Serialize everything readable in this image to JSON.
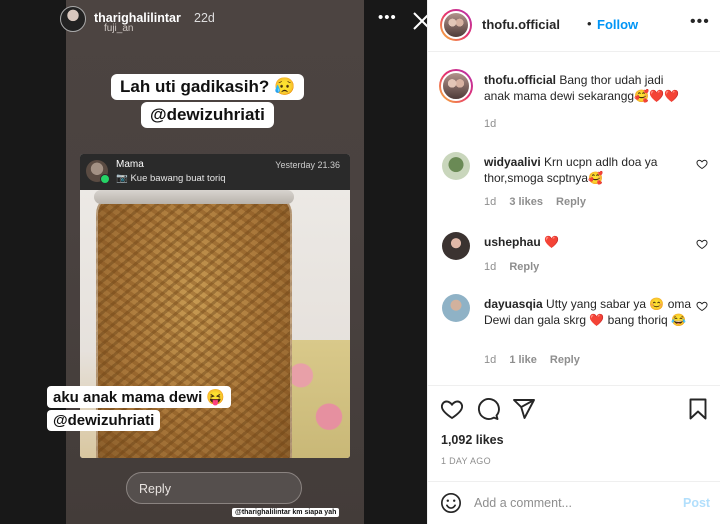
{
  "story": {
    "username": "tharighalilintar",
    "time": "22d",
    "subtext": "fuji_an",
    "sticker_line1": "Lah uti gadikasih? 😥",
    "sticker_line2": "@dewizuhriati",
    "notification": {
      "title": "Mama",
      "message": "📷 Kue bawang buat toriq",
      "time": "Yesterday 21.36"
    },
    "caption_line1": "aku anak mama dewi 😝",
    "caption_line2": "@dewizuhriati",
    "reply_placeholder": "Reply",
    "footer_tag": "@tharighalilintar km siapa yah"
  },
  "post": {
    "header": {
      "username": "thofu.official",
      "dot": "•",
      "follow_label": "Follow"
    },
    "caption": {
      "username": "thofu.official",
      "text": "Bang thor udah jadi anak mama dewi sekarangg🥰❤️❤️",
      "age": "1d"
    },
    "comments": [
      {
        "username": "widyaalivi",
        "text": "Krn ucpn adlh doa ya thor,smoga scptnya🥰",
        "age": "1d",
        "likes": "3 likes",
        "reply": "Reply"
      },
      {
        "username": "ushephau",
        "text": "❤️",
        "age": "1d",
        "reply": "Reply"
      },
      {
        "username": "dayuasqia",
        "text": "Utty yang sabar ya 😊 oma Dewi dan gala skrg ❤️ bang thoriq 😂",
        "age": "1d",
        "likes": "1 like",
        "reply": "Reply"
      }
    ],
    "likes": "1,092 likes",
    "date": "1 DAY AGO",
    "add_comment_placeholder": "Add a comment...",
    "post_label": "Post"
  },
  "icons": {
    "close": "close-icon",
    "more": "more-icon",
    "like": "heart-icon",
    "comment": "comment-icon",
    "share": "share-icon",
    "save": "bookmark-icon",
    "emoji": "emoji-icon"
  },
  "colors": {
    "accent": "#0095f6",
    "post_disabled": "#b2dffc",
    "meta_gray": "#8e8e8e"
  }
}
